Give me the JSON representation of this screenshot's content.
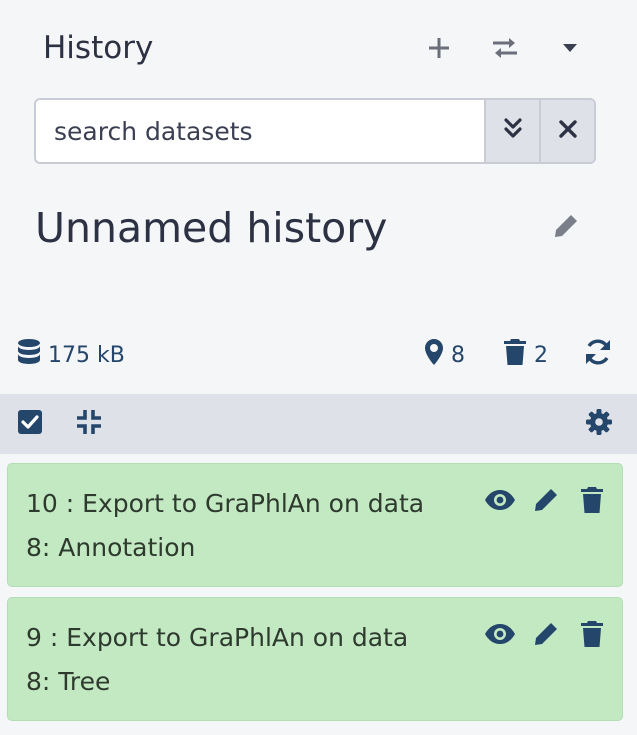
{
  "header": {
    "title": "History",
    "icons": {
      "new": "plus-icon",
      "switch": "exchange-icon",
      "menu": "caret-down-icon"
    }
  },
  "search": {
    "placeholder": "search datasets",
    "value": "",
    "icons": {
      "advanced": "double-chevron-down-icon",
      "clear": "times-icon"
    }
  },
  "history": {
    "name": "Unnamed history",
    "edit_icon": "pencil-icon"
  },
  "stats": {
    "size": "175 kB",
    "shown_count": "8",
    "deleted_count": "2",
    "icons": {
      "size": "database-icon",
      "shown": "map-marker-icon",
      "deleted": "trash-icon",
      "refresh": "sync-icon"
    }
  },
  "toolbar": {
    "icons": {
      "select": "check-square-icon",
      "collapse": "compress-icon",
      "settings": "gear-icon"
    }
  },
  "datasets": [
    {
      "title_line1": "10 : Export to GraPhlAn on data",
      "title_line2": "8: Annotation",
      "state": "ok"
    },
    {
      "title_line1": "9 : Export to GraPhlAn on data",
      "title_line2": "8: Tree",
      "state": "ok"
    }
  ],
  "colors": {
    "text": "#2c3143",
    "link": "#24466b",
    "ok_bg": "#c3e9c3",
    "toolbar_bg": "#dee1e7",
    "muted_icon": "#6b6f7b"
  }
}
